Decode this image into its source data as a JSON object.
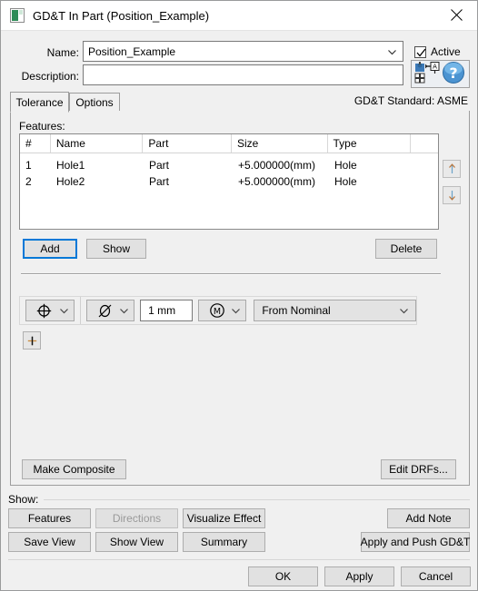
{
  "window": {
    "title": "GD&T In Part (Position_Example)",
    "icon": "app-icon",
    "close_icon": "close-icon"
  },
  "form": {
    "name_label": "Name:",
    "name_value": "Position_Example",
    "description_label": "Description:",
    "description_value": "",
    "active_label": "Active",
    "active_checked": true,
    "datum_icon": "datum-annotation-icon",
    "help_icon": "help-icon"
  },
  "tabs": {
    "items": [
      {
        "label": "Tolerance",
        "selected": true
      },
      {
        "label": "Options",
        "selected": false
      }
    ],
    "standard_text": "GD&T Standard: ASME"
  },
  "features": {
    "label": "Features:",
    "columns": [
      "#",
      "Name",
      "Part",
      "Size",
      "Type",
      ""
    ],
    "rows": [
      {
        "num": "1",
        "name": "Hole1",
        "part": "Part",
        "size": "+5.000000(mm)",
        "type": "Hole"
      },
      {
        "num": "2",
        "name": "Hole2",
        "part": "Part",
        "size": "+5.000000(mm)",
        "type": "Hole"
      }
    ],
    "move_up_icon": "arrow-up-icon",
    "move_down_icon": "arrow-down-icon",
    "add_label": "Add",
    "show_label": "Show",
    "delete_label": "Delete"
  },
  "tolerance_frame": {
    "characteristic_icon": "position-symbol-icon",
    "diameter_icon": "diameter-symbol-icon",
    "tolerance_value": "1 mm",
    "material_modifier_icon": "mmc-symbol-icon",
    "zone_basis": "From Nominal",
    "add_row_label": "+"
  },
  "actions": {
    "make_composite_label": "Make Composite",
    "edit_drfs_label": "Edit DRFs..."
  },
  "show_group": {
    "label": "Show:",
    "features_label": "Features",
    "directions_label": "Directions",
    "directions_disabled": true,
    "visualize_effect_label": "Visualize Effect",
    "add_note_label": "Add Note",
    "save_view_label": "Save View",
    "show_view_label": "Show View",
    "summary_label": "Summary",
    "apply_push_label": "Apply and Push GD&T"
  },
  "footer": {
    "ok_label": "OK",
    "apply_label": "Apply",
    "cancel_label": "Cancel"
  }
}
